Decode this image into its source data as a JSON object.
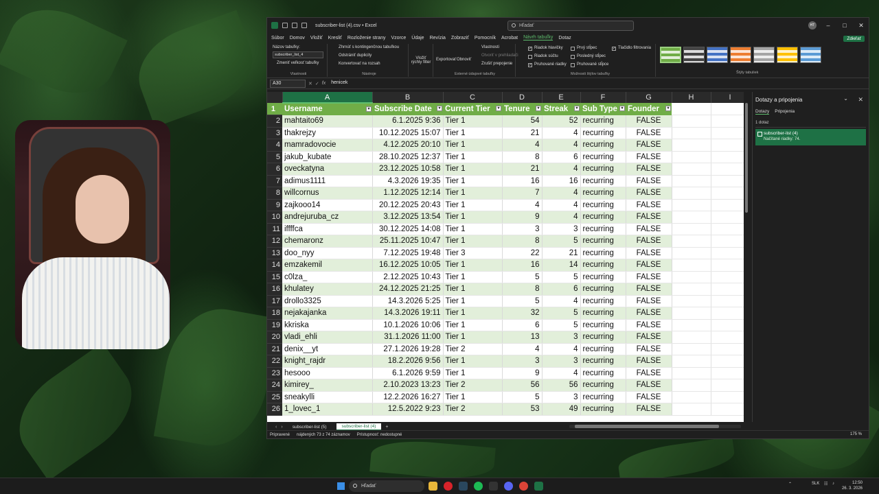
{
  "window": {
    "title": "subscriber-list (4).csv • Excel",
    "search_placeholder": "Hľadať",
    "avatar_initials": "HT"
  },
  "menu": {
    "items": [
      "Súbor",
      "Domov",
      "Vložiť",
      "Kresliť",
      "Rozloženie strany",
      "Vzorce",
      "Údaje",
      "Revízia",
      "Zobraziť",
      "Pomocník",
      "Acrobat",
      "Návrh tabuľky",
      "Dotaz"
    ],
    "active_index": 11,
    "share_label": "Zdieľať"
  },
  "ribbon": {
    "table_name_label": "Názov tabuľky:",
    "table_name_value": "subscriber_list_4",
    "resize_label": "Zmeniť veľkosť tabuľky",
    "group_properties": "Vlastnosti",
    "pivot_label": "Zhrnúť s kontingenčnou tabuľkou",
    "remove_dup_label": "Odstrániť duplicity",
    "convert_label": "Konvertovať na rozsah",
    "group_tools": "Nástroje",
    "slicer_label": "Vložiť rýchly filter",
    "export_label": "Exportovať",
    "refresh_label": "Obnoviť",
    "props_label": "Vlastnosti",
    "open_browser_label": "Otvoriť v prehliadači",
    "unlink_label": "Zrušiť prepojenie",
    "group_external": "Externé údajové tabuľky",
    "opt_header_row": "Riadok hlavičky",
    "opt_total_row": "Riadok súčtu",
    "opt_banded_rows": "Pruhované riadky",
    "opt_first_col": "Prvý stĺpec",
    "opt_last_col": "Posledný stĺpec",
    "opt_banded_cols": "Pruhované stĺpce",
    "opt_filter_button": "Tlačidlo filtrovania",
    "group_style_options": "Možnosti štýlov tabuľky",
    "group_styles": "Štýly tabuliek"
  },
  "formula_bar": {
    "cell_ref": "A30",
    "fx": "fx",
    "value": "henicek"
  },
  "grid": {
    "columns": [
      "A",
      "B",
      "C",
      "D",
      "E",
      "F",
      "G",
      "H",
      "I"
    ],
    "headers": [
      "Username",
      "Subscribe Date",
      "Current Tier",
      "Tenure",
      "Streak",
      "Sub Type",
      "Founder"
    ],
    "rows": [
      [
        "mahtaito69",
        "6.1.2025 9:36",
        "Tier 1",
        "54",
        "52",
        "recurring",
        "FALSE"
      ],
      [
        "thakrejzy",
        "10.12.2025 15:07",
        "Tier 1",
        "21",
        "4",
        "recurring",
        "FALSE"
      ],
      [
        "mamradovocie",
        "4.12.2025 20:10",
        "Tier 1",
        "4",
        "4",
        "recurring",
        "FALSE"
      ],
      [
        "jakub_kubate",
        "28.10.2025 12:37",
        "Tier 1",
        "8",
        "6",
        "recurring",
        "FALSE"
      ],
      [
        "oveckatyna",
        "23.12.2025 10:58",
        "Tier 1",
        "21",
        "4",
        "recurring",
        "FALSE"
      ],
      [
        "adimus1111",
        "4.3.2026 19:35",
        "Tier 1",
        "16",
        "16",
        "recurring",
        "FALSE"
      ],
      [
        "willcornus",
        "1.12.2025 12:14",
        "Tier 1",
        "7",
        "4",
        "recurring",
        "FALSE"
      ],
      [
        "zajkooo14",
        "20.12.2025 20:43",
        "Tier 1",
        "4",
        "4",
        "recurring",
        "FALSE"
      ],
      [
        "andrejuruba_cz",
        "3.12.2025 13:54",
        "Tier 1",
        "9",
        "4",
        "recurring",
        "FALSE"
      ],
      [
        "iffffca",
        "30.12.2025 14:08",
        "Tier 1",
        "3",
        "3",
        "recurring",
        "FALSE"
      ],
      [
        "chemaronz",
        "25.11.2025 10:47",
        "Tier 1",
        "8",
        "5",
        "recurring",
        "FALSE"
      ],
      [
        "doo_nyy",
        "7.12.2025 19:48",
        "Tier 3",
        "22",
        "21",
        "recurring",
        "FALSE"
      ],
      [
        "emzakemil",
        "16.12.2025 10:05",
        "Tier 1",
        "16",
        "14",
        "recurring",
        "FALSE"
      ],
      [
        "c0lza_",
        "2.12.2025 10:43",
        "Tier 1",
        "5",
        "5",
        "recurring",
        "FALSE"
      ],
      [
        "khulatey",
        "24.12.2025 21:25",
        "Tier 1",
        "8",
        "6",
        "recurring",
        "FALSE"
      ],
      [
        "drollo3325",
        "14.3.2026 5:25",
        "Tier 1",
        "5",
        "4",
        "recurring",
        "FALSE"
      ],
      [
        "nejakajanka",
        "14.3.2026 19:11",
        "Tier 1",
        "32",
        "5",
        "recurring",
        "FALSE"
      ],
      [
        "kkriska",
        "10.1.2026 10:06",
        "Tier 1",
        "6",
        "5",
        "recurring",
        "FALSE"
      ],
      [
        "vladi_ehli",
        "31.1.2026 11:00",
        "Tier 1",
        "13",
        "3",
        "recurring",
        "FALSE"
      ],
      [
        "denix__yt",
        "27.1.2026 19:28",
        "Tier 2",
        "4",
        "4",
        "recurring",
        "FALSE"
      ],
      [
        "knight_rajdr",
        "18.2.2026 9:56",
        "Tier 1",
        "3",
        "3",
        "recurring",
        "FALSE"
      ],
      [
        "hesooo",
        "6.1.2026 9:59",
        "Tier 1",
        "9",
        "4",
        "recurring",
        "FALSE"
      ],
      [
        "kimirey_",
        "2.10.2023 13:23",
        "Tier 2",
        "56",
        "56",
        "recurring",
        "FALSE"
      ],
      [
        "sneakylli",
        "12.2.2026 16:27",
        "Tier 1",
        "5",
        "3",
        "recurring",
        "FALSE"
      ],
      [
        "1_lovec_1",
        "12.5.2022 9:23",
        "Tier 2",
        "53",
        "49",
        "recurring",
        "FALSE"
      ]
    ]
  },
  "sheets": {
    "tabs": [
      "subscriber-list (5)",
      "subscriber-list (4)"
    ],
    "active_index": 1,
    "add": "+"
  },
  "status": {
    "ready": "Pripravené",
    "found": "nájdených 73 z 74 záznamov",
    "accessibility": "Prístupnosť: nedostupné",
    "zoom": "175 %"
  },
  "queries_pane": {
    "title": "Dotazy a pripojenia",
    "tab_queries": "Dotazy",
    "tab_connections": "Pripojenia",
    "count": "1 dotaz",
    "item_name": "subscriber-list (4)",
    "item_sub": "Načítané riadky: 74."
  },
  "taskbar": {
    "search_placeholder": "Hľadať",
    "lang": "SLK",
    "time": "12:50",
    "date": "26. 3. 2026"
  },
  "colors": {
    "excel_green": "#1e7145",
    "table_header": "#70ad47",
    "band": "#e2efda"
  }
}
